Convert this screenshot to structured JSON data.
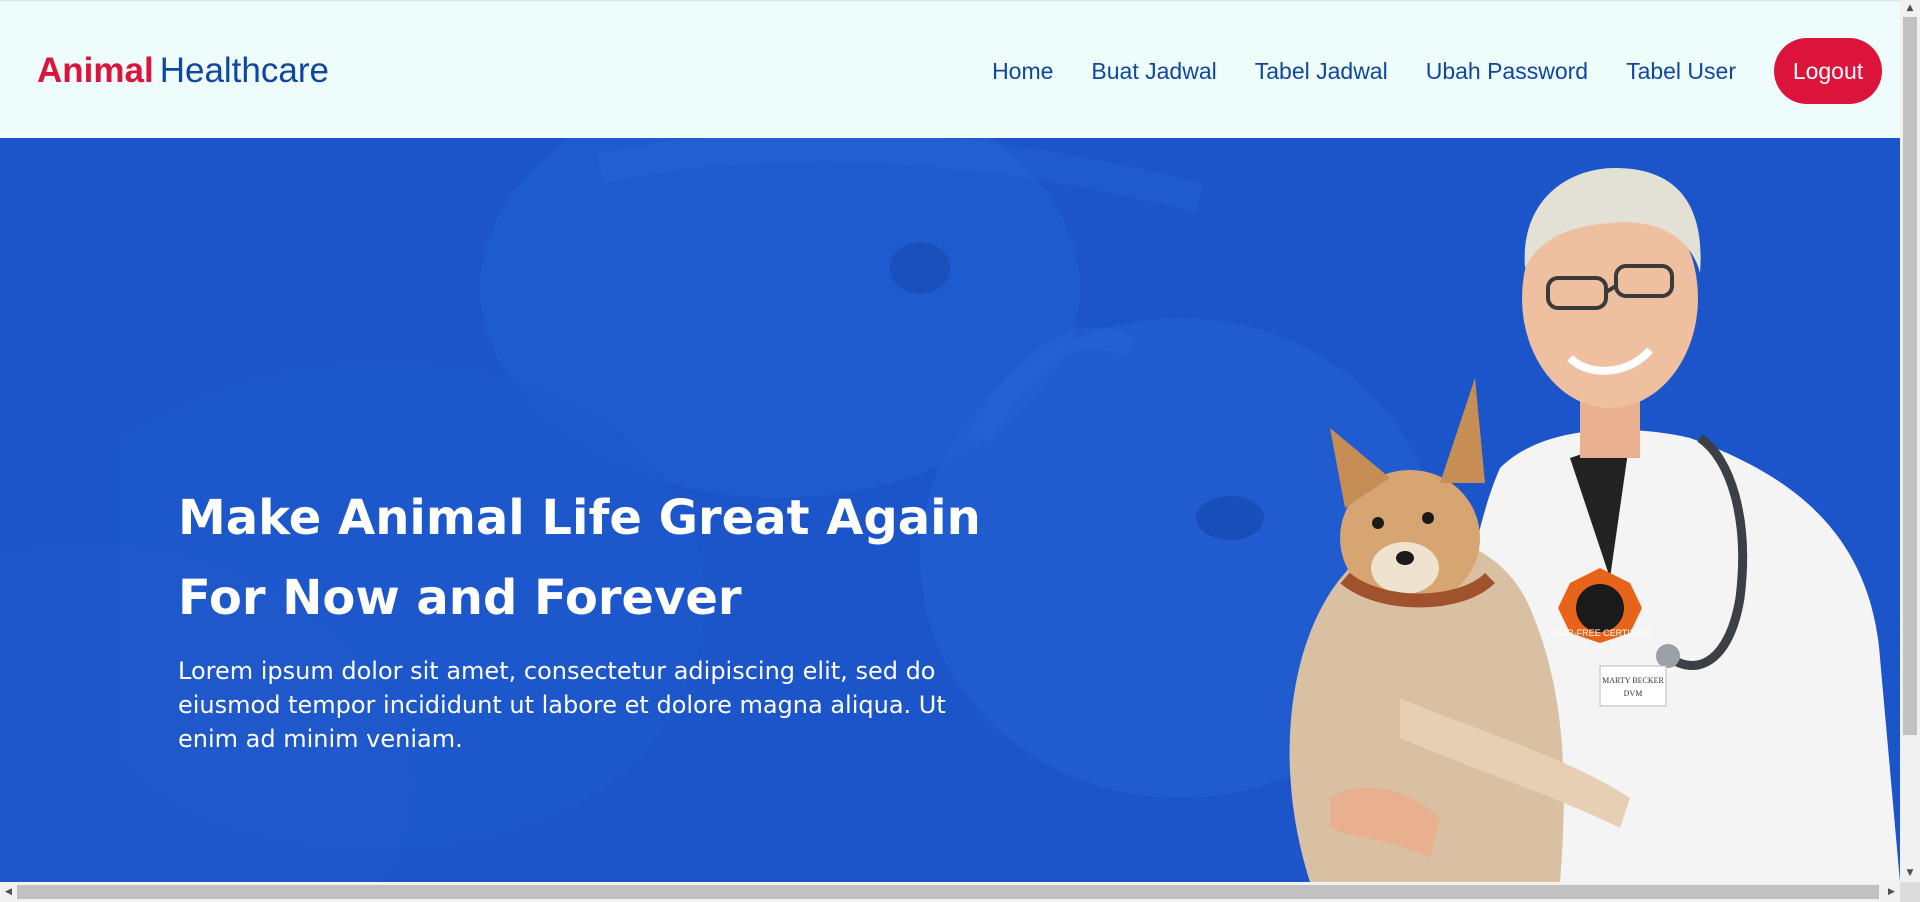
{
  "header": {
    "brand_part1": "Animal",
    "brand_part2": "Healthcare",
    "nav": {
      "home": "Home",
      "buat_jadwal": "Buat Jadwal",
      "tabel_jadwal": "Tabel Jadwal",
      "ubah_password": "Ubah Password",
      "tabel_user": "Tabel User"
    },
    "logout_label": "Logout"
  },
  "hero": {
    "title_line1": "Make Animal Life Great Again",
    "title_line2": "For Now and Forever",
    "description": "Lorem ipsum dolor sit amet, consectetur adipiscing elit, sed do eiusmod tempor incididunt ut labore et dolore magna aliqua. Ut enim ad minim veniam.",
    "badge_text": "FEAR-FREE CERTIFIED",
    "name_tag_line1": "MARTY BECKER",
    "name_tag_line2": "DVM"
  },
  "colors": {
    "brand_red": "#dc143c",
    "brand_blue": "#0d47a1",
    "header_bg": "#effcfc",
    "hero_bg": "#1b55c9"
  },
  "icons": {
    "scroll_up": "triangle-up-icon",
    "scroll_down": "triangle-down-icon",
    "scroll_left": "triangle-left-icon",
    "scroll_right": "triangle-right-icon"
  }
}
